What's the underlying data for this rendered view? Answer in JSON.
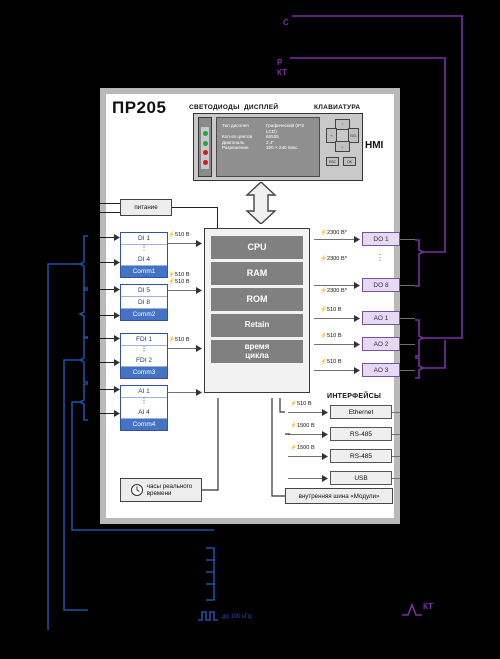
{
  "device": {
    "title": "ПР205",
    "hmi_label": "HMI",
    "sections": {
      "leds": "СВЕТОДИОДЫ",
      "display": "ДИСПЛЕЙ",
      "keyboard": "КЛАВИАТУРА",
      "interfaces": "ИНТЕРФЕЙСЫ"
    }
  },
  "display_specs": [
    {
      "key": "Тип дисплея",
      "value": "Графический (IPS LCD)"
    },
    {
      "key": "Кол-во цветов",
      "value": "65535"
    },
    {
      "key": "Диагональ",
      "value": "2,4\""
    },
    {
      "key": "Разрешение",
      "value": "320 × 240 пикс."
    }
  ],
  "leds": [
    {
      "color": "#1faa3c"
    },
    {
      "color": "#1faa3c"
    },
    {
      "color": "#d41a1a"
    },
    {
      "color": "#d41a1a"
    }
  ],
  "keypad": {
    "up": "⌃",
    "down": "⌄",
    "left": "«",
    "select": "SEL",
    "esc": "ESC",
    "ok": "OK"
  },
  "cpu": {
    "cells": [
      "CPU",
      "RAM",
      "ROM",
      "Retain",
      "время\nцикла"
    ]
  },
  "power": {
    "label": "питание"
  },
  "inputs": [
    {
      "name": "di-1-4",
      "first": "DI 1",
      "dots": true,
      "last": "DI 4",
      "comm": "Comm1"
    },
    {
      "name": "di-5-8",
      "first": "DI 5",
      "dots": false,
      "last": "DI 8",
      "comm": "Comm2"
    },
    {
      "name": "fdi-1-2",
      "first": "FDI 1",
      "dots": true,
      "last": "FDI 2",
      "comm": "Comm3"
    },
    {
      "name": "ai-1-4",
      "first": "AI 1",
      "dots": true,
      "last": "AI 4",
      "comm": "Comm4"
    }
  ],
  "input_isolation": [
    "510 В",
    "510 В",
    "510 В",
    "510 В"
  ],
  "digital_outputs": {
    "first": "DO 1",
    "last": "DO 8",
    "isolation": [
      "2300 В*",
      "2300 В*",
      "2300 В*"
    ]
  },
  "analog_outputs": [
    {
      "label": "AO 1",
      "isolation": "510 В"
    },
    {
      "label": "AO 2",
      "isolation": "510 В"
    },
    {
      "label": "AO 3",
      "isolation": "510 В"
    }
  ],
  "interfaces": [
    {
      "label": "Ethernet",
      "isolation": "510 В"
    },
    {
      "label": "RS-485",
      "isolation": "1500 В"
    },
    {
      "label": "RS-485",
      "isolation": "1500 В"
    },
    {
      "label": "USB",
      "isolation": ""
    }
  ],
  "rtc": {
    "label": "часы реального\nвремени"
  },
  "module_bus": {
    "label": "внутренняя шина «Модули»"
  },
  "annotations": {
    "frequency": "до 100 кГц",
    "top_partial_1": "Р",
    "top_partial_2": "КТ",
    "top_partial_3": "С",
    "bottom_partial": "КТ"
  },
  "colors": {
    "input_accent": "#4472c4",
    "output_accent": "#7b4ea8",
    "panel_frame": "#b9b9b9",
    "cpu_cell": "#808080",
    "blue_wire": "#1f4fa8",
    "purple_wire": "#7b2fa8"
  }
}
